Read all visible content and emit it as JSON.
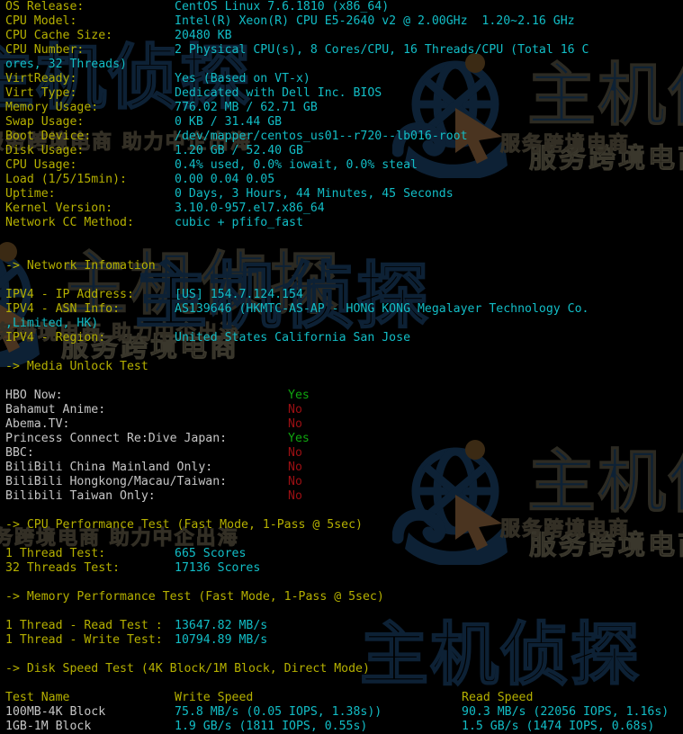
{
  "terminal": {
    "background": "#000000",
    "label_color": "#b5b000",
    "value_color": "#12bdc6",
    "header_color": "#b5b000",
    "media_label_color": "#c6c6c6",
    "yes_color": "#0fa50f",
    "no_color": "#9c0f13",
    "line_height_px": 16,
    "font_size_px": 13
  },
  "watermark": {
    "brand": "主机侦探",
    "tagline": "服务跨境电商",
    "tagline2": "助力中企出海",
    "logo_color": "#0d2135",
    "cursor_color": "#4a3420"
  },
  "system_info": [
    {
      "label": "OS Release:",
      "value": "CentOS Linux 7.6.1810 (x86_64)"
    },
    {
      "label": "CPU Model:",
      "value": "Intel(R) Xeon(R) CPU E5-2640 v2 @ 2.00GHz  1.20~2.16 GHz"
    },
    {
      "label": "CPU Cache Size:",
      "value": "20480 KB"
    },
    {
      "label": "CPU Number:",
      "value": "2 Physical CPU(s), 8 Cores/CPU, 16 Threads/CPU (Total 16 C"
    },
    {
      "label": "",
      "value": ""
    },
    {
      "label": "VirtReady:",
      "value": "Yes (Based on VT-x)"
    },
    {
      "label": "Virt Type:",
      "value": "Dedicated with Dell Inc. BIOS"
    },
    {
      "label": "Memory Usage:",
      "value": "776.02 MB / 62.71 GB"
    },
    {
      "label": "Swap Usage:",
      "value": "0 KB / 31.44 GB"
    },
    {
      "label": "Boot Device:",
      "value": "/dev/mapper/centos_us01--r720--lb016-root"
    },
    {
      "label": "Disk Usage:",
      "value": "1.20 GB / 52.40 GB"
    },
    {
      "label": "CPU Usage:",
      "value": "0.4% used, 0.0% iowait, 0.0% steal"
    },
    {
      "label": "Load (1/5/15min):",
      "value": "0.00 0.04 0.05"
    },
    {
      "label": "Uptime:",
      "value": "0 Days, 3 Hours, 44 Minutes, 45 Seconds"
    },
    {
      "label": "Kernel Version:",
      "value": "3.10.0-957.el7.x86_64"
    },
    {
      "label": "Network CC Method:",
      "value": "cubic + pfifo_fast"
    }
  ],
  "cpu_number_wrap": "ores, 32 Threads)",
  "sections": {
    "network": "-> Network Infomation",
    "media": "-> Media Unlock Test",
    "cpu_perf": "-> CPU Performance Test (Fast Mode, 1-Pass @ 5sec)",
    "mem_perf": "-> Memory Performance Test (Fast Mode, 1-Pass @ 5sec)",
    "disk": "-> Disk Speed Test (4K Block/1M Block, Direct Mode)"
  },
  "network_info": [
    {
      "label": "IPV4 - IP Address:",
      "value": "[US] 154.7.124.154"
    },
    {
      "label": "IPV4 - ASN Info:",
      "value": "AS139646 (HKMTC-AS-AP - HONG KONG Megalayer Technology Co."
    },
    {
      "label": "IPV4 - Region:",
      "value": "United States California San Jose"
    }
  ],
  "asn_wrap": ",Limited, HK)",
  "media_unlock": [
    {
      "label": "HBO Now:",
      "status": "Yes"
    },
    {
      "label": "Bahamut Anime:",
      "status": "No"
    },
    {
      "label": "Abema.TV:",
      "status": "No"
    },
    {
      "label": "Princess Connect Re:Dive Japan:",
      "status": "Yes"
    },
    {
      "label": "BBC:",
      "status": "No"
    },
    {
      "label": "BiliBili China Mainland Only:",
      "status": "No"
    },
    {
      "label": "BiliBili Hongkong/Macau/Taiwan:",
      "status": "No"
    },
    {
      "label": "Bilibili Taiwan Only:",
      "status": "No"
    }
  ],
  "cpu_perf": [
    {
      "label": "1 Thread Test:",
      "value": "665 Scores"
    },
    {
      "label": "32 Threads Test:",
      "value": "17136 Scores"
    }
  ],
  "mem_perf": [
    {
      "label": "1 Thread - Read Test :",
      "value": "13647.82 MB/s"
    },
    {
      "label": "1 Thread - Write Test:",
      "value": "10794.89 MB/s"
    }
  ],
  "disk_speed": {
    "headers": {
      "name": "Test Name",
      "write": "Write Speed",
      "read": "Read Speed"
    },
    "rows": [
      {
        "name": "100MB-4K Block",
        "write": "75.8 MB/s (0.05 IOPS, 1.38s))",
        "read": "90.3 MB/s (22056 IOPS, 1.16s)"
      },
      {
        "name": "1GB-1M Block",
        "write": "1.9 GB/s (1811 IOPS, 0.55s)",
        "read": "1.5 GB/s (1474 IOPS, 0.68s)"
      }
    ]
  }
}
